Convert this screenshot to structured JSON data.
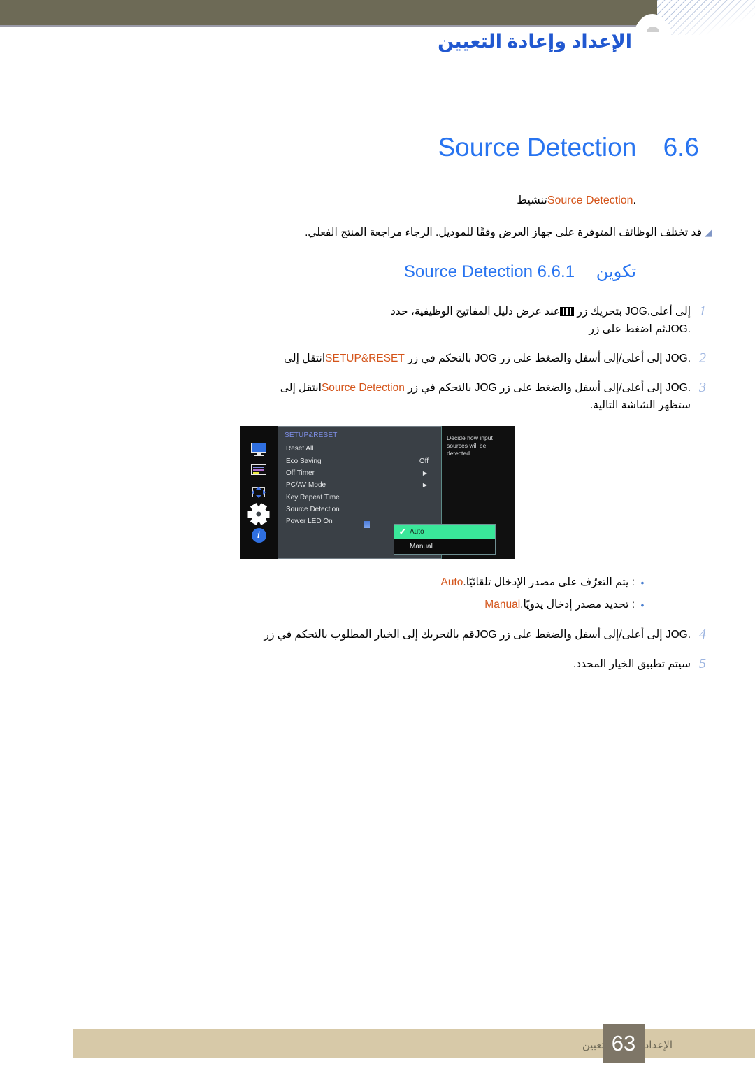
{
  "header": {
    "title": "الإعداد وإعادة التعيين"
  },
  "section": {
    "number": "6.6",
    "title_en": "Source Detection",
    "lead_prefix": "تنشيط ",
    "lead_en": "Source Detection",
    "lead_suffix": "."
  },
  "note": {
    "bullet": "◢",
    "text": "قد تختلف الوظائف المتوفرة على جهاز العرض وفقًا للموديل. الرجاء مراجعة المنتج الفعلي."
  },
  "subsection": {
    "number": "6.6.1",
    "title_ar": "تكوين",
    "title_en": "Source Detection"
  },
  "steps": [
    {
      "num": "1",
      "line1_a": "عند عرض دليل المفاتيح الوظيفية، حدد ",
      "icon": "osd-bars-icon",
      "line1_b": " بتحريك زر ",
      "en1": "JOG",
      "line1_c": " إلى أعلى.",
      "line2_a": "ثم اضغط على زر ",
      "en2": "JOG",
      "line2_b": "."
    },
    {
      "num": "2",
      "text_a": "انتقل إلى ",
      "orange": "SETUP&RESET",
      "text_b": " بالتحكم في زر ",
      "en1": "JOG",
      "text_c": " إلى أعلى/إلى أسفل والضغط على زر ",
      "en2": "JOG",
      "text_d": "."
    },
    {
      "num": "3",
      "text_a": "انتقل إلى ",
      "orange": "Source Detection",
      "text_b": " بالتحكم في زر ",
      "en1": "JOG",
      "text_c": " إلى أعلى/إلى أسفل والضغط على زر ",
      "en2": "JOG",
      "text_d": ".",
      "line2": "ستظهر الشاشة التالية."
    },
    {
      "num": "4",
      "text_a": "قم بالتحريك إلى الخيار المطلوب بالتحكم في زر ",
      "en1": "JOG",
      "text_c": " إلى أعلى/إلى أسفل والضغط على زر ",
      "en2": "JOG",
      "text_d": "."
    },
    {
      "num": "5",
      "text_a": "سيتم تطبيق الخيار المحدد."
    }
  ],
  "osd": {
    "icons": [
      {
        "name": "monitor-icon",
        "label": "Picture"
      },
      {
        "name": "osd-panel-icon",
        "label": "OnScreen Display"
      },
      {
        "name": "screen-size-icon",
        "label": "Screen Adjustment"
      },
      {
        "name": "gear-icon",
        "label": "Setup and Reset"
      },
      {
        "name": "info-icon",
        "label": "Information"
      }
    ],
    "menu_title": "SETUP&RESET",
    "rows": [
      {
        "label": "Reset All",
        "value": "",
        "arrow": ""
      },
      {
        "label": "Eco Saving",
        "value": "Off",
        "arrow": ""
      },
      {
        "label": "Off Timer",
        "value": "",
        "arrow": "▶"
      },
      {
        "label": "PC/AV Mode",
        "value": "",
        "arrow": "▶"
      },
      {
        "label": "Key Repeat Time",
        "value": "",
        "arrow": ""
      },
      {
        "label": "Source Detection",
        "value": "",
        "arrow": ""
      },
      {
        "label": "Power LED On",
        "value": "",
        "arrow": ""
      }
    ],
    "description": "Decide how input sources will be detected.",
    "popup": {
      "check": "✔",
      "items": [
        {
          "label": "Auto",
          "selected": true
        },
        {
          "label": "Manual",
          "selected": false
        }
      ]
    },
    "colors": {
      "panel": "#3a4046",
      "highlight": "#3ae79a",
      "title": "#7f8fe8"
    }
  },
  "options": [
    {
      "bullet": "•",
      "name": "Auto",
      "desc": ": يتم التعرّف على مصدر الإدخال تلقائيًا."
    },
    {
      "bullet": "•",
      "name": "Manual",
      "desc": ": تحديد مصدر إدخال يدويًا."
    }
  ],
  "footer": {
    "text": "الإعداد وإعادة التعيين",
    "page": "63"
  }
}
